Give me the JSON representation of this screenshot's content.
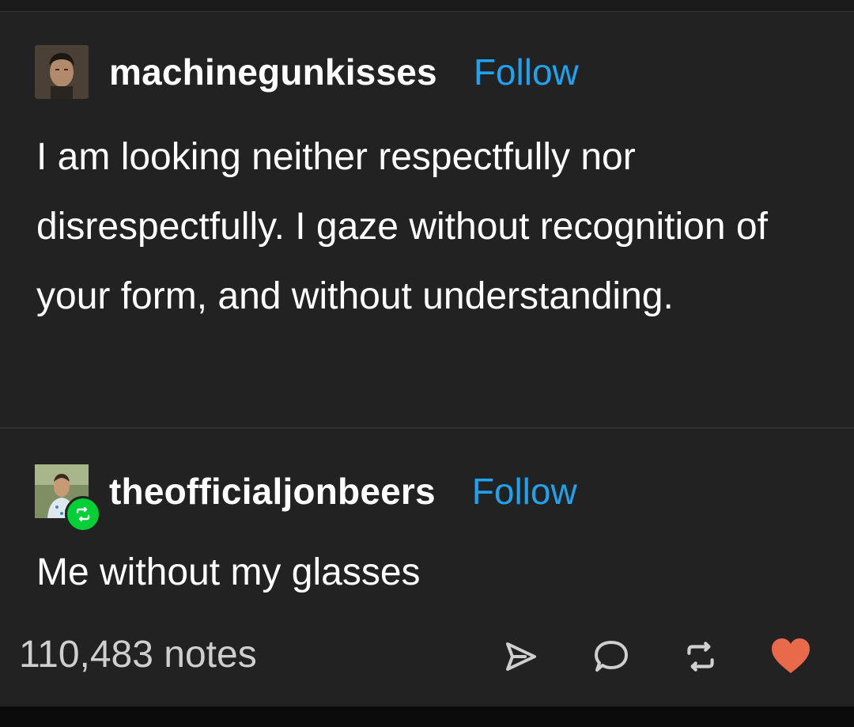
{
  "posts": [
    {
      "username": "machinegunkisses",
      "follow_label": "Follow",
      "text": "I am looking neither respectfully nor disrespectfully. I gaze without recognition of your form, and without understanding.",
      "avatar_icon": "avatar-man-dark-hair"
    },
    {
      "username": "theofficialjonbeers",
      "follow_label": "Follow",
      "text": "Me without my glasses",
      "avatar_icon": "avatar-man-outdoors",
      "badge_icon": "reblog-icon"
    }
  ],
  "footer": {
    "notes": "110,483 notes",
    "actions": [
      "share-icon",
      "reply-icon",
      "reblog-icon",
      "like-icon"
    ]
  },
  "colors": {
    "background": "#222222",
    "follow": "#1fa3ee",
    "like": "#e86a4b",
    "reblog_badge": "#00cf35",
    "notes": "#cfcfcf"
  }
}
